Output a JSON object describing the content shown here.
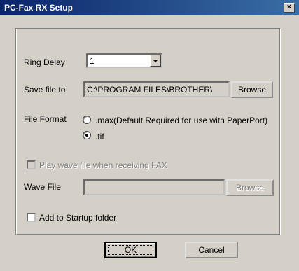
{
  "window": {
    "title": "PC-Fax RX Setup",
    "close_glyph": "×"
  },
  "ring_delay": {
    "label": "Ring Delay",
    "value": "1"
  },
  "save_file": {
    "label": "Save file to",
    "value": "C:\\PROGRAM FILES\\BROTHER\\",
    "browse_label": "Browse"
  },
  "file_format": {
    "label": "File Format",
    "options": [
      {
        "label": ".max(Default Required for use with PaperPort)",
        "selected": false
      },
      {
        "label": ".tif",
        "selected": true
      }
    ]
  },
  "play_wave": {
    "label": "Play wave file when receiving FAX",
    "checked": false,
    "enabled": false
  },
  "wave_file": {
    "label": "Wave File",
    "value": "",
    "browse_label": "Browse",
    "enabled": false
  },
  "startup": {
    "label": "Add to Startup folder",
    "checked": false
  },
  "buttons": {
    "ok": "OK",
    "cancel": "Cancel"
  }
}
